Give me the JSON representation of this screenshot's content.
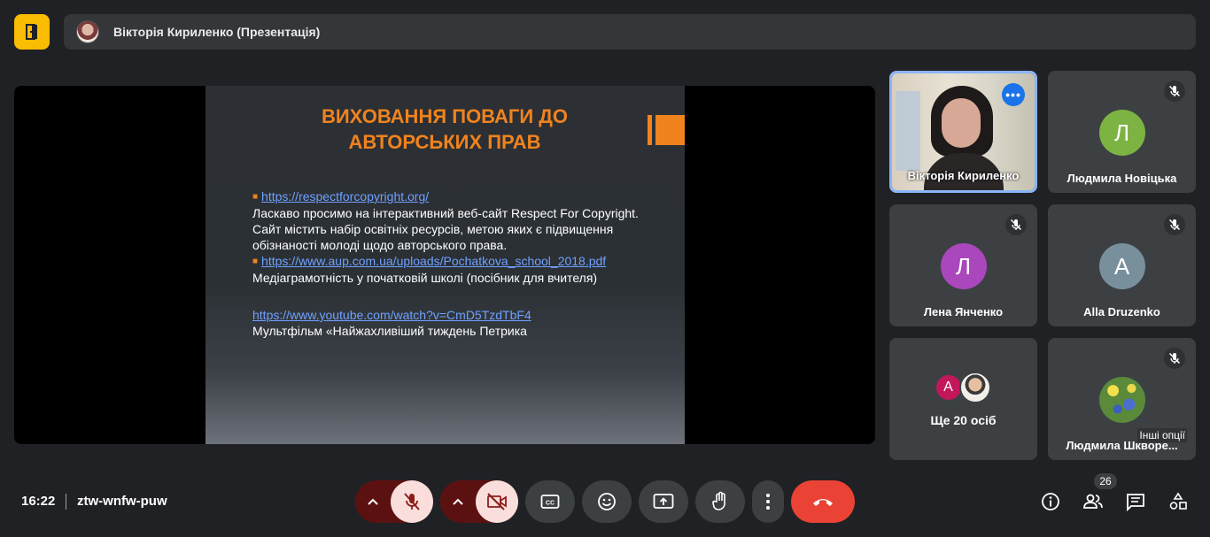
{
  "header": {
    "presenter_label": "Вікторія Кириленко (Презентація)"
  },
  "slide": {
    "title": "ВИХОВАННЯ ПОВАГИ ДО АВТОРСЬКИХ ПРАВ",
    "link1": "https://respectforcopyright.org/",
    "text1": "Ласкаво просимо на інтерактивний веб-сайт Respect For Copyright. Сайт містить набір освітніх ресурсів, метою яких є підвищення обізнаності молоді щодо авторського права.",
    "link2": "https://www.aup.com.ua/uploads/Pochatkova_school_2018.pdf",
    "text2": "Медіаграмотність у початковій школі (посібник для вчителя)",
    "link3": "https://www.youtube.com/watch?v=CmD5TzdTbF4",
    "text3": "Мультфільм «Найжахливіший тиждень Петрика"
  },
  "participants": [
    {
      "name": "Вікторія Кириленко",
      "initial": "",
      "color": "",
      "video": true
    },
    {
      "name": "Людмила Новіцька",
      "initial": "Л",
      "color": "#7cb342",
      "muted": true
    },
    {
      "name": "Лена Янченко",
      "initial": "Л",
      "color": "#ab47bc",
      "muted": true
    },
    {
      "name": "Alla Druzenko",
      "initial": "А",
      "color": "#78909c",
      "muted": true
    },
    {
      "name": "Людмила Шкворе...",
      "initial": "",
      "color": "",
      "muted": true
    }
  ],
  "others": {
    "label": "Ще 20 осіб",
    "initial": "А",
    "color": "#c2185b"
  },
  "tooltip": "Інші опції",
  "footer": {
    "time": "16:22",
    "meeting_code": "ztw-wnfw-puw",
    "participants_count": "26"
  },
  "colors": {
    "accent_orange": "#f0831e",
    "hangup_red": "#ea4335",
    "door_yellow": "#fbbc04",
    "active_border": "#8ab4f8"
  }
}
